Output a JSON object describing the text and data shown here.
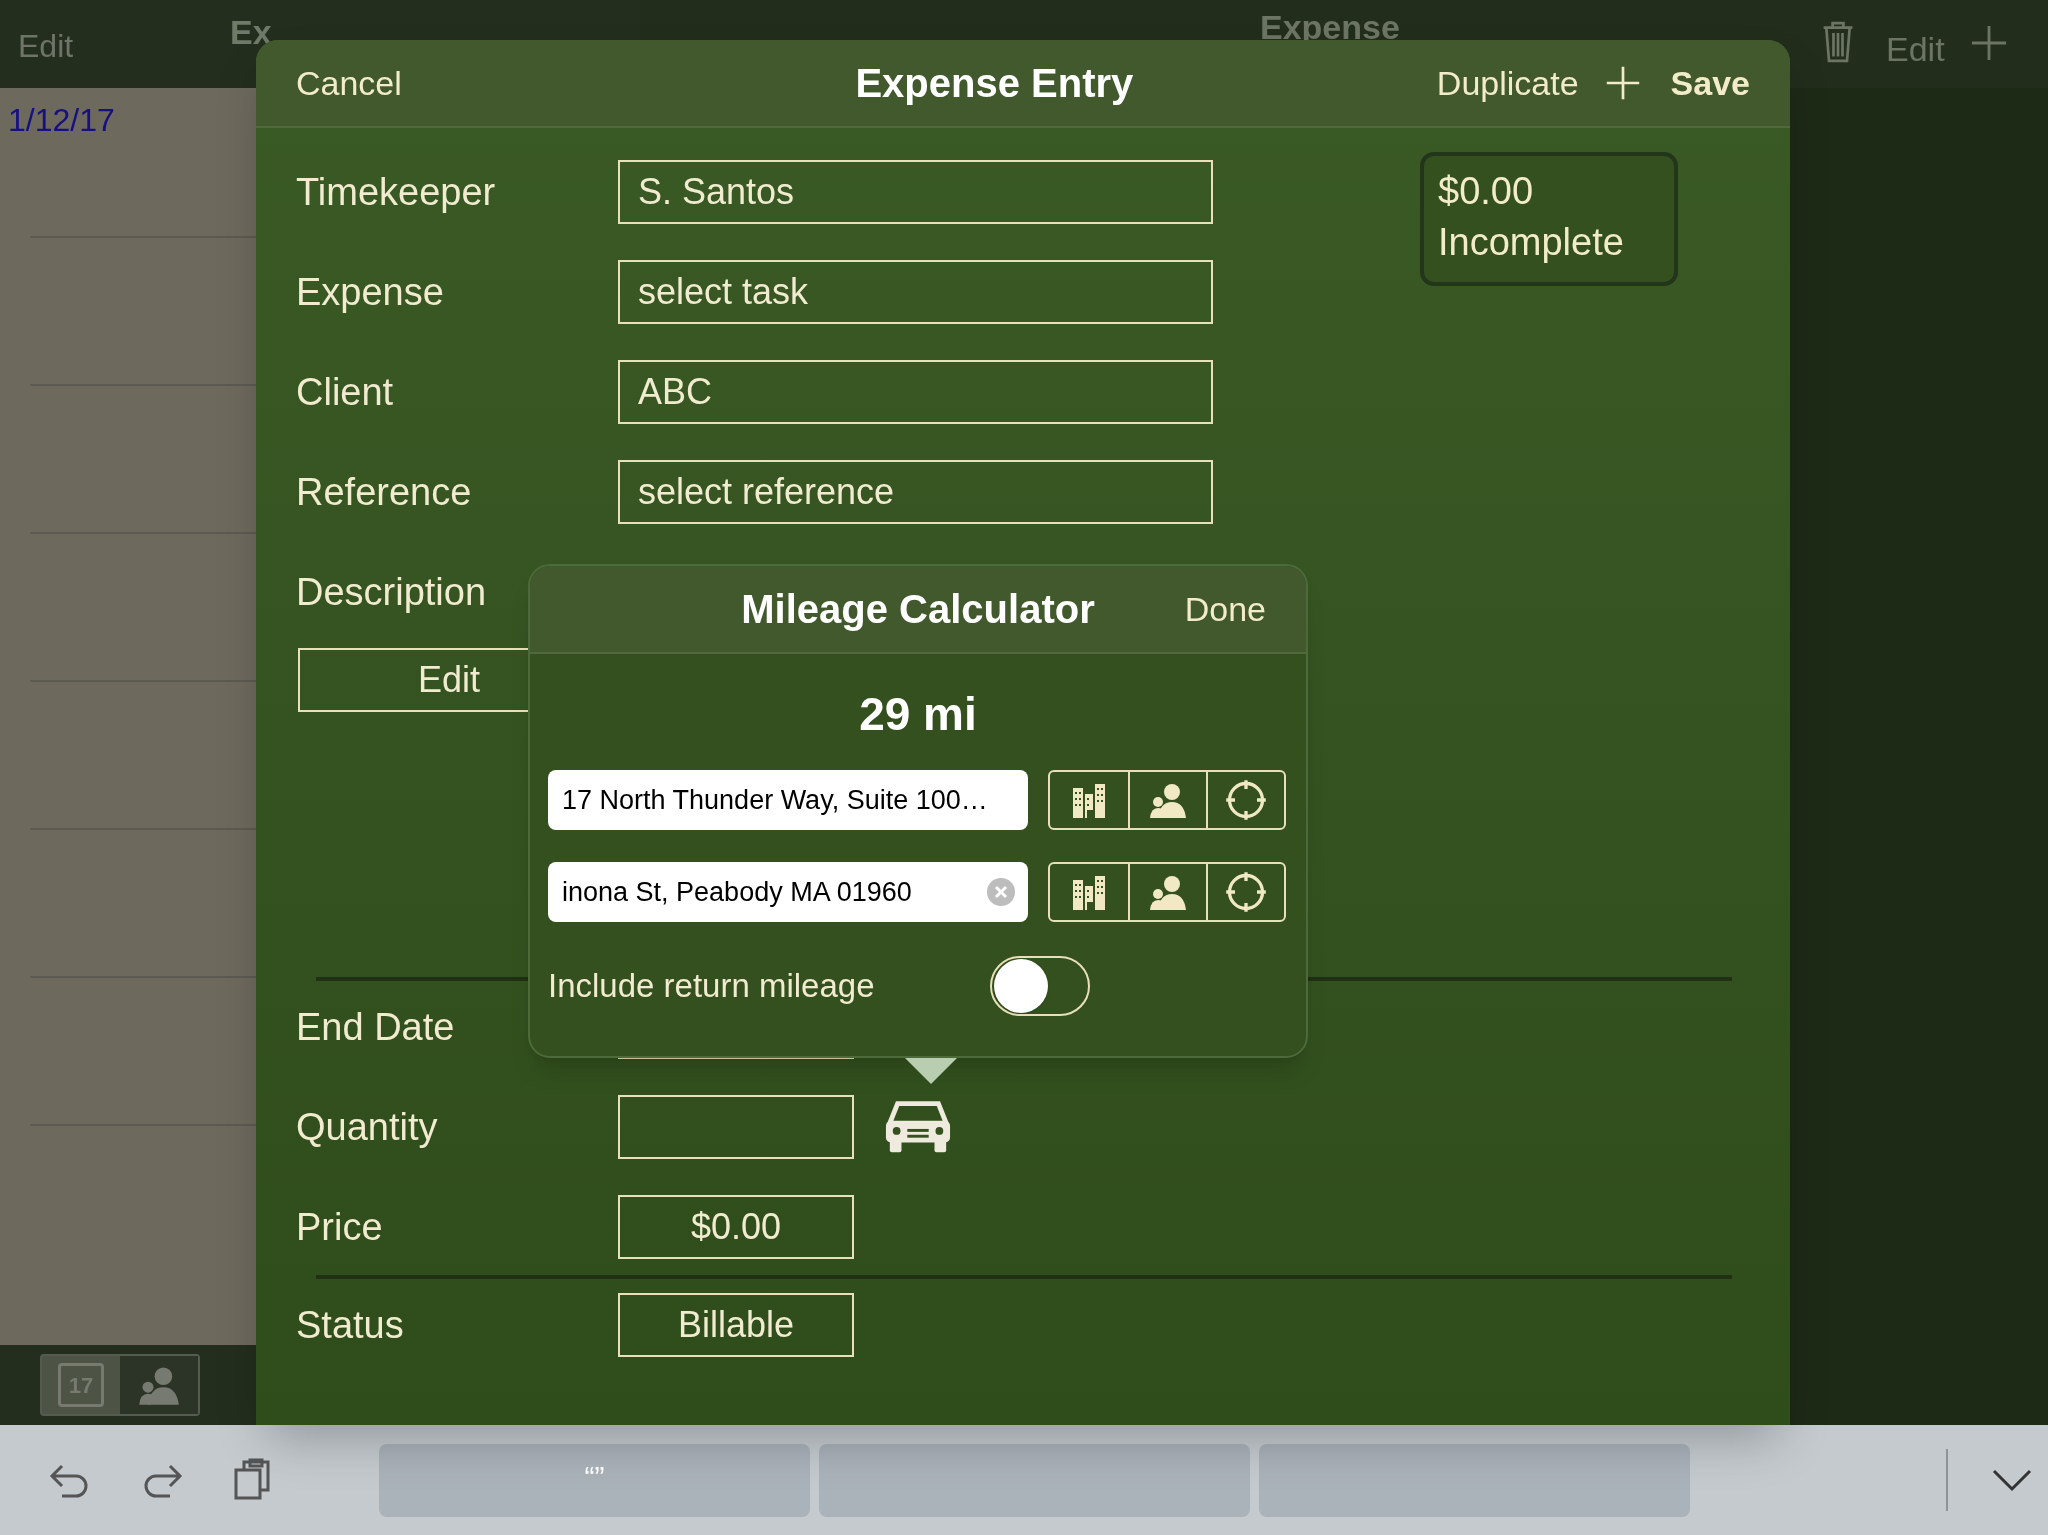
{
  "background": {
    "left_header": {
      "edit": "Edit",
      "title": "Ex"
    },
    "list": {
      "date": "1/12/17"
    },
    "right_header": {
      "title": "Expense",
      "edit": "Edit"
    },
    "bottom_tabs": [
      {
        "kind": "calendar",
        "label": "17",
        "selected": true
      },
      {
        "kind": "contacts",
        "selected": false
      }
    ]
  },
  "modal": {
    "cancel": "Cancel",
    "title": "Expense Entry",
    "duplicate": "Duplicate",
    "save": "Save",
    "summary": {
      "amount": "$0.00",
      "status": "Incomplete"
    },
    "rows": [
      {
        "kind": "wide",
        "label": "Timekeeper",
        "value": "S. Santos"
      },
      {
        "kind": "wide",
        "label": "Expense",
        "value": "select task"
      },
      {
        "kind": "wide",
        "label": "Client",
        "value": "ABC"
      },
      {
        "kind": "wide",
        "label": "Reference",
        "value": "select reference"
      },
      {
        "kind": "description",
        "label": "Description",
        "button": "Edit"
      },
      {
        "kind": "divider"
      },
      {
        "kind": "short",
        "label": "End Date"
      },
      {
        "kind": "mileage",
        "label": "Quantity"
      },
      {
        "kind": "short",
        "label": "Price",
        "value": "$0.00"
      },
      {
        "kind": "divider"
      },
      {
        "kind": "short",
        "label": "Status",
        "value": "Billable"
      }
    ]
  },
  "popover": {
    "title": "Mileage Calculator",
    "done": "Done",
    "distance": "29 mi",
    "addresses": [
      {
        "value": "17 North Thunder Way, Suite 100…",
        "clear_button": false
      },
      {
        "value": "inona St, Peabody MA 01960",
        "clear_button": true
      }
    ],
    "toggle": {
      "label": "Include return mileage",
      "on": false
    }
  },
  "keyboard_bar": {
    "suggestions": [
      "“”"
    ]
  }
}
